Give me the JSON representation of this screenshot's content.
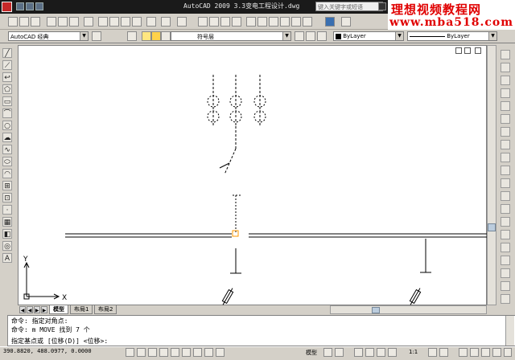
{
  "window": {
    "title": "AutoCAD 2009  3.3变电工程设计.dwg",
    "search_placeholder": "键入关键字或短语"
  },
  "watermark": {
    "line1": "理想视频教程网",
    "line2": "www.mba518.com"
  },
  "toolbar2": {
    "workspace": "AutoCAD 经典",
    "layer": "符号层",
    "color": "ByLayer",
    "linetype": "ByLayer"
  },
  "ucs": {
    "y_label": "Y",
    "x_label": "X"
  },
  "tabs": [
    {
      "label": "模型",
      "active": true
    },
    {
      "label": "布局1",
      "active": false
    },
    {
      "label": "布局2",
      "active": false
    }
  ],
  "command": {
    "lines": [
      "命令: 指定对角点:",
      "命令: m MOVE 找到 7 个",
      "指定基点或 [位移(D)] <位移>:"
    ]
  },
  "status": {
    "coordinates": "390.8820, 488.0977, 0.0000",
    "model_label": "模型",
    "scale": "1:1"
  },
  "colors": {
    "title_bg": "#1a1a1a",
    "watermark_red": "#e00000",
    "selection_orange": "#ff9900",
    "canvas_bg": "#ffffff"
  }
}
